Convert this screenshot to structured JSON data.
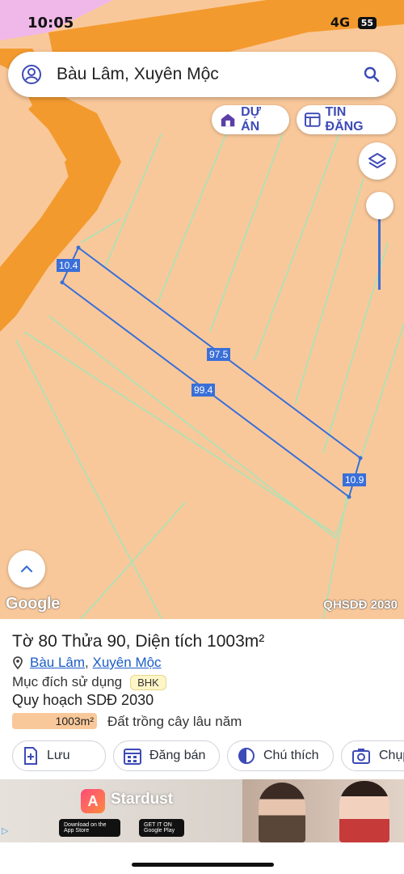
{
  "status_bar": {
    "time": "10:05",
    "right_text": "4G",
    "battery": "55"
  },
  "search": {
    "query": "Bàu Lâm, Xuyên Mộc"
  },
  "map_buttons": {
    "du_an": "DỰ ÁN",
    "tin_dang": "TIN ĐĂNG"
  },
  "map": {
    "dimensions": [
      "10.4",
      "97.5",
      "99.4",
      "10.9"
    ],
    "google_label": "Google",
    "plan_label": "QHSDĐ 2030",
    "land_color": "#f9c89a",
    "road_color": "#f39a2e",
    "boundary_color": "#3a6fd8"
  },
  "sheet": {
    "title": "Tờ 80 Thửa 90, Diện tích 1003m²",
    "commune": "Bàu Lâm",
    "separator": ",",
    "district": "Xuyên Mộc",
    "purpose_label": "Mục đích sử dụng",
    "purpose_code": "BHK",
    "plan_title": "Quy hoạch SDĐ 2030",
    "area": "1003m²",
    "land_type": "Đất trồng cây lâu năm",
    "actions": [
      "Lưu",
      "Đăng bán",
      "Chú thích",
      "Chụp"
    ]
  },
  "ad": {
    "brand": "Stardust",
    "app_store": "Download on the App Store",
    "google_play": "GET IT ON Google Play"
  }
}
